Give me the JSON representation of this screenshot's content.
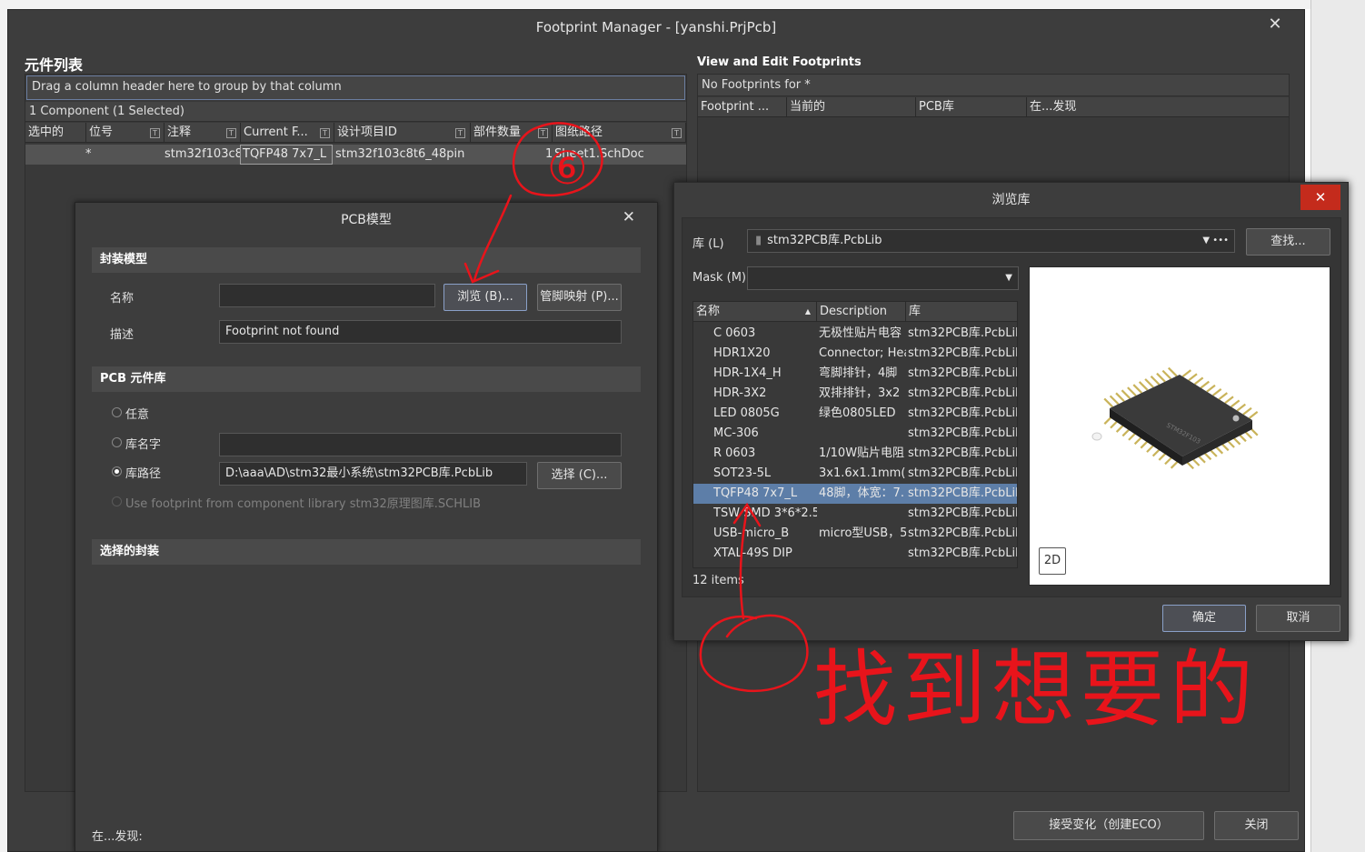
{
  "fm": {
    "title": "Footprint Manager - [yanshi.PrjPcb]",
    "component_list_title": "元件列表",
    "group_hint": "Drag a column header here to group by that column",
    "component_count": "1 Component (1 Selected)",
    "columns": [
      "选中的",
      "位号",
      "注释",
      "Current F...",
      "设计项目ID",
      "部件数量",
      "图纸路径"
    ],
    "row": {
      "selected": "",
      "designator": "*",
      "comment": "stm32f103c8",
      "current": "TQFP48 7x7_L",
      "design_id": "stm32f103c8t6_48pin",
      "parts": "1",
      "sheet": "Sheet1.SchDoc"
    },
    "view_edit_title": "View and Edit Footprints",
    "no_footprints": "No Footprints for *",
    "right_columns": [
      "Footprint ...",
      "当前的",
      "PCB库",
      "在...发现"
    ],
    "accept_button": "接受变化（创建ECO）",
    "close_button": "关闭"
  },
  "pcb": {
    "title": "PCB模型",
    "section_footprint": "封装模型",
    "name_label": "名称",
    "name_value": "",
    "browse_button": "浏览 (B)...",
    "pin_map_button": "管脚映射 (P)...",
    "desc_label": "描述",
    "desc_value": "Footprint not found",
    "section_library": "PCB 元件库",
    "radio_any": "任意",
    "radio_libname": "库名字",
    "radio_libpath": "库路径",
    "libpath_value": "D:\\aaa\\AD\\stm32最小系统\\stm32PCB库.PcbLib",
    "select_button": "选择 (C)...",
    "use_component_lib": "Use footprint from component library stm32原理图库.SCHLIB",
    "section_selected": "选择的封装",
    "found_in": "在...发现:"
  },
  "browse": {
    "title": "浏览库",
    "lib_label": "库 (L)",
    "lib_value": "stm32PCB库.PcbLib",
    "find_button": "查找...",
    "mask_label": "Mask (M)",
    "mask_value": "",
    "columns": [
      "名称",
      "Description",
      "库"
    ],
    "items": [
      {
        "name": "C 0603",
        "desc": "无极性贴片电容",
        "lib": "stm32PCB库.PcbLib"
      },
      {
        "name": "HDR1X20",
        "desc": "Connector; Hea",
        "lib": "stm32PCB库.PcbLib"
      },
      {
        "name": "HDR-1X4_H",
        "desc": "弯脚排针，4脚",
        "lib": "stm32PCB库.PcbLib"
      },
      {
        "name": "HDR-3X2",
        "desc": "双排排针，3x2",
        "lib": "stm32PCB库.PcbLib"
      },
      {
        "name": "LED 0805G",
        "desc": "绿色0805LED",
        "lib": "stm32PCB库.PcbLib"
      },
      {
        "name": "MC-306",
        "desc": "",
        "lib": "stm32PCB库.PcbLib"
      },
      {
        "name": "R 0603",
        "desc": "1/10W贴片电阻",
        "lib": "stm32PCB库.PcbLib"
      },
      {
        "name": "SOT23-5L",
        "desc": "3x1.6x1.1mm(长",
        "lib": "stm32PCB库.PcbLib"
      },
      {
        "name": "TQFP48 7x7_L",
        "desc": "48脚，体宽：7.",
        "lib": "stm32PCB库.PcbLib"
      },
      {
        "name": "TSW SMD 3*6*2.5",
        "desc": "",
        "lib": "stm32PCB库.PcbLib"
      },
      {
        "name": "USB-micro_B",
        "desc": "micro型USB，5",
        "lib": "stm32PCB库.PcbLib"
      },
      {
        "name": "XTAL-49S DIP",
        "desc": "",
        "lib": "stm32PCB库.PcbLib"
      }
    ],
    "selected_index": 8,
    "item_count": "12 items",
    "view_2d": "2D",
    "ok_button": "确定",
    "cancel_button": "取消"
  },
  "annotations": {
    "step": "⑥",
    "note": "找到想要的",
    "color": "#e8141b"
  }
}
